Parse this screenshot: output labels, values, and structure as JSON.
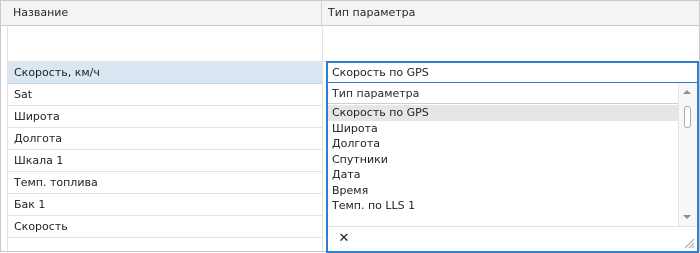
{
  "grid": {
    "columns": [
      "Название",
      "Тип параметра"
    ],
    "rows": [
      "Скорость, км/ч",
      "Sat",
      "Широта",
      "Долгота",
      "Шкала 1",
      "Темп. топлива",
      "Бак 1",
      "Скорость"
    ],
    "selected_row_index": 0
  },
  "editor": {
    "value": "Скорость по GPS"
  },
  "dropdown": {
    "header": "Тип параметра",
    "items": [
      "Скорость по GPS",
      "Широта",
      "Долгота",
      "Спутники",
      "Дата",
      "Время",
      "Темп. по LLS  1"
    ],
    "highlighted_index": 0,
    "close_icon": "x-icon"
  },
  "colors": {
    "accent": "#2f7fd0",
    "selected_row": "#dbe6f3",
    "highlight": "#e6e6e6"
  }
}
